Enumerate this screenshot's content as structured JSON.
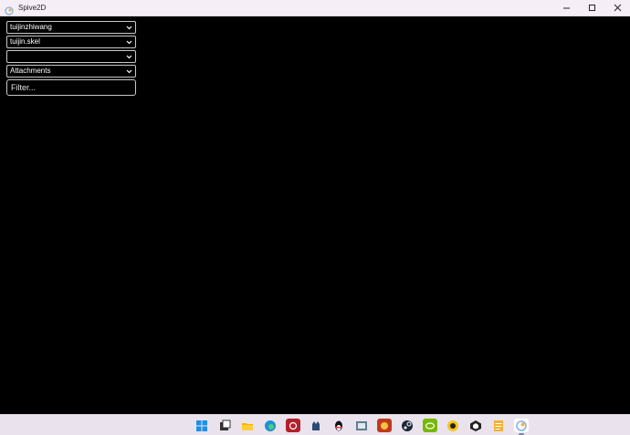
{
  "window": {
    "title": "Spive2D"
  },
  "selects": [
    {
      "value": "tuijinzhiwang"
    },
    {
      "value": "tuijin.skel"
    },
    {
      "value": ""
    },
    {
      "value": "Attachments"
    }
  ],
  "filter": {
    "placeholder": "Filter..."
  },
  "taskbar": {
    "icons": [
      "windows-start-icon",
      "task-view-icon",
      "file-explorer-icon",
      "edge-icon",
      "red-chat-app-icon",
      "cat-app-icon",
      "qq-penguin-icon",
      "terminal-app-icon",
      "game-app-icon",
      "steam-icon",
      "nvidia-icon",
      "yellow-p-app-icon",
      "unity-icon",
      "notes-app-icon",
      "spive2d-icon"
    ]
  },
  "colors": {
    "titlebar": "#f6eef6",
    "canvas": "#000000",
    "taskbar": "#eae3ee",
    "control_border": "#c8c8c8"
  }
}
